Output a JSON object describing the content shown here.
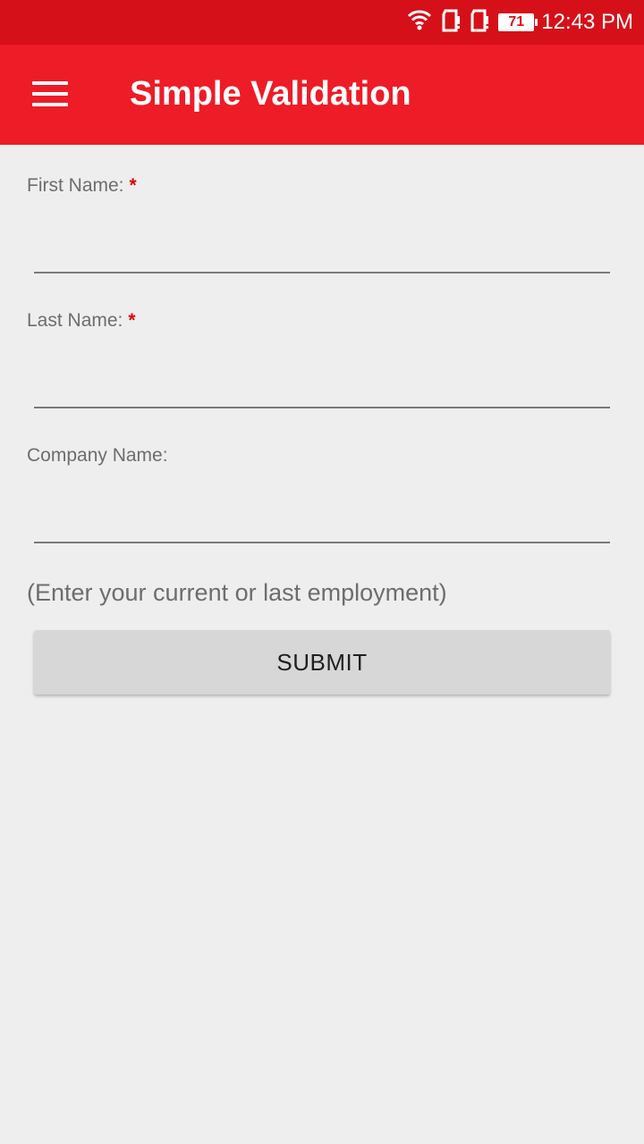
{
  "status_bar": {
    "time": "12:43 PM",
    "battery_level": "71",
    "icons": [
      "wifi-icon",
      "sim-1-icon",
      "sim-2-icon",
      "battery-icon"
    ]
  },
  "app_bar": {
    "title": "Simple Validation",
    "menu_icon": "hamburger-menu-icon",
    "color": "#ed1c27"
  },
  "form": {
    "first_name": {
      "label": "First Name:",
      "required_mark": "*",
      "value": ""
    },
    "last_name": {
      "label": "Last Name:",
      "required_mark": "*",
      "value": ""
    },
    "company_name": {
      "label": "Company Name:",
      "value": ""
    },
    "hint": "(Enter your current or last employment)",
    "submit_label": "SUBMIT"
  },
  "colors": {
    "status_bar": "#d51019",
    "required": "#e00000",
    "background": "#eeeeee"
  }
}
